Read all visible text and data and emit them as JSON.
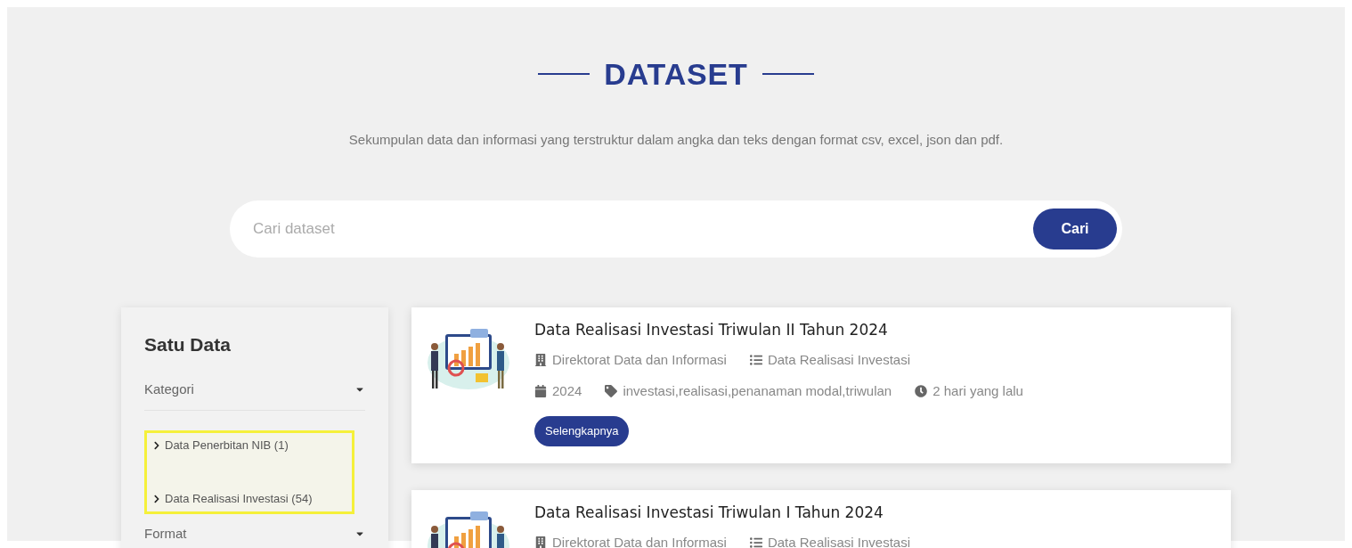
{
  "header": {
    "title": "DATASET",
    "subtitle": "Sekumpulan data dan informasi yang terstruktur dalam angka dan teks dengan format csv, excel, json dan pdf."
  },
  "search": {
    "placeholder": "Cari dataset",
    "button": "Cari"
  },
  "sidebar": {
    "title": "Satu Data",
    "sections": [
      {
        "label": "Kategori",
        "highlighted": true,
        "items": [
          {
            "label": "Data Penerbitan NIB (1)"
          },
          {
            "label": "Data Realisasi Investasi (54)"
          }
        ]
      },
      {
        "label": "Format"
      }
    ]
  },
  "datasets": [
    {
      "title": "Data Realisasi Investasi Triwulan II Tahun 2024",
      "organization": "Direktorat Data dan Informasi",
      "category": "Data Realisasi Investasi",
      "year": "2024",
      "tags": "investasi,realisasi,penanaman modal,triwulan",
      "time": "2 hari yang lalu",
      "button": "Selengkapnya"
    },
    {
      "title": "Data Realisasi Investasi Triwulan I Tahun 2024",
      "organization": "Direktorat Data dan Informasi",
      "category": "Data Realisasi Investasi"
    }
  ]
}
